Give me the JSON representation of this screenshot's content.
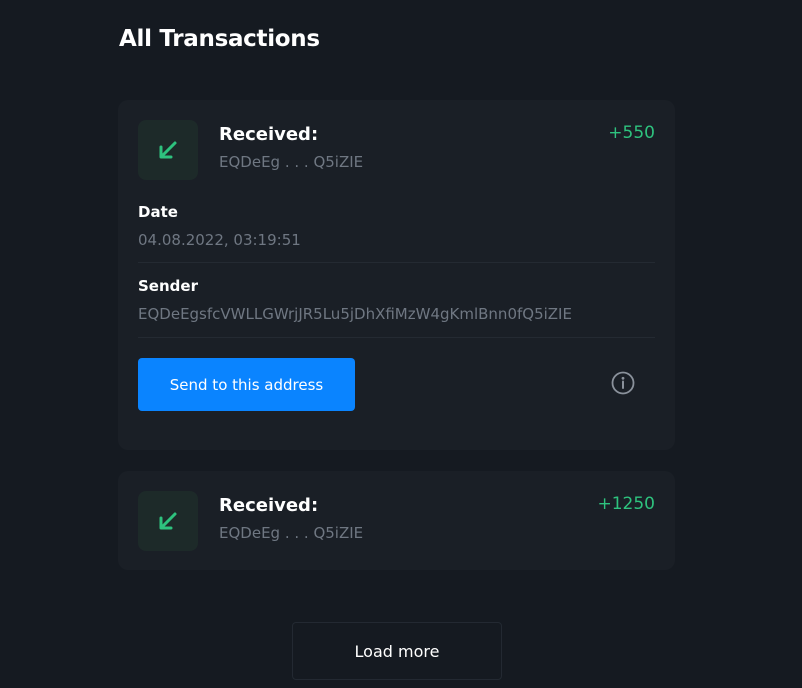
{
  "page": {
    "title": "All Transactions"
  },
  "transactions": [
    {
      "type": "Received:",
      "address_short": "EQDeEg . . . Q5iZIE",
      "amount": "+550",
      "icon": "arrow-down-left-icon",
      "expanded": true,
      "date_label": "Date",
      "date_value": "04.08.2022, 03:19:51",
      "sender_label": "Sender",
      "sender_value": "EQDeEgsfcVWLLGWrjJR5Lu5jDhXfiMzW4gKmlBnn0fQ5iZIE",
      "send_button_label": "Send to this address",
      "info_icon": "info-icon"
    },
    {
      "type": "Received:",
      "address_short": "EQDeEg . . . Q5iZIE",
      "amount": "+1250",
      "icon": "arrow-down-left-icon",
      "expanded": false
    }
  ],
  "load_more_label": "Load more",
  "colors": {
    "background": "#151a21",
    "card": "#1a1f26",
    "accent": "#0a84ff",
    "positive": "#2ec27e",
    "muted": "#6f7782"
  }
}
